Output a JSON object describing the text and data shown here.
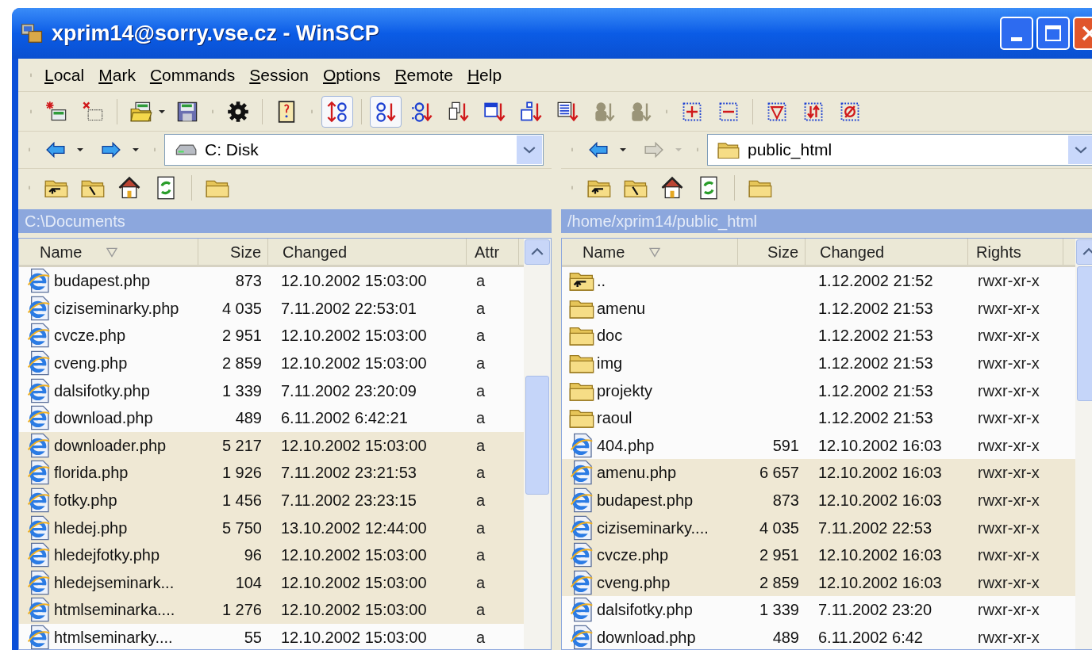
{
  "window": {
    "title": "xprim14@sorry.vse.cz - WinSCP"
  },
  "menu": [
    "Local",
    "Mark",
    "Commands",
    "Session",
    "Options",
    "Remote",
    "Help"
  ],
  "toolbar": [
    {
      "kind": "grip"
    },
    {
      "kind": "new-session",
      "pressed": false
    },
    {
      "kind": "close-session",
      "pressed": false
    },
    {
      "kind": "sep"
    },
    {
      "kind": "open",
      "pressed": false
    },
    {
      "kind": "save",
      "pressed": false
    },
    {
      "kind": "grip"
    },
    {
      "kind": "gear",
      "pressed": false
    },
    {
      "kind": "sep"
    },
    {
      "kind": "book",
      "pressed": false
    },
    {
      "kind": "grip"
    },
    {
      "kind": "sort-toggle",
      "pressed": true
    },
    {
      "kind": "sep"
    },
    {
      "kind": "sort-name",
      "pressed": true
    },
    {
      "kind": "sort-ext",
      "pressed": false
    },
    {
      "kind": "sort-type",
      "pressed": false
    },
    {
      "kind": "sort-date",
      "pressed": false
    },
    {
      "kind": "sort-size",
      "pressed": false
    },
    {
      "kind": "sort-attr",
      "pressed": false
    },
    {
      "kind": "sort-owner",
      "pressed": false
    },
    {
      "kind": "sort-group",
      "pressed": false
    },
    {
      "kind": "grip"
    },
    {
      "kind": "select-plus",
      "pressed": false
    },
    {
      "kind": "select-minus",
      "pressed": false
    },
    {
      "kind": "sep"
    },
    {
      "kind": "select-filter",
      "pressed": false
    },
    {
      "kind": "select-invert",
      "pressed": false
    },
    {
      "kind": "select-none",
      "pressed": false
    }
  ],
  "panels": [
    {
      "nav": [
        {
          "kind": "back",
          "disabled": false
        },
        {
          "kind": "forward",
          "disabled": false
        }
      ],
      "location": {
        "kind": "drive",
        "value": "C: Disk"
      },
      "path": "C:\\Documents",
      "columns": [
        "Name",
        "Size",
        "Changed",
        "Attr"
      ],
      "rows": [
        {
          "kind": "file",
          "name": "budapest.php",
          "size": "873",
          "changed": "12.10.2002 15:03:00",
          "extra": "a",
          "selected": false
        },
        {
          "kind": "file",
          "name": "ciziseminarky.php",
          "size": "4 035",
          "changed": "7.11.2002 22:53:01",
          "extra": "a",
          "selected": false
        },
        {
          "kind": "file",
          "name": "cvcze.php",
          "size": "2 951",
          "changed": "12.10.2002 15:03:00",
          "extra": "a",
          "selected": false
        },
        {
          "kind": "file",
          "name": "cveng.php",
          "size": "2 859",
          "changed": "12.10.2002 15:03:00",
          "extra": "a",
          "selected": false
        },
        {
          "kind": "file",
          "name": "dalsifotky.php",
          "size": "1 339",
          "changed": "7.11.2002 23:20:09",
          "extra": "a",
          "selected": false
        },
        {
          "kind": "file",
          "name": "download.php",
          "size": "489",
          "changed": "6.11.2002 6:42:21",
          "extra": "a",
          "selected": false
        },
        {
          "kind": "file",
          "name": "downloader.php",
          "size": "5 217",
          "changed": "12.10.2002 15:03:00",
          "extra": "a",
          "selected": true
        },
        {
          "kind": "file",
          "name": "florida.php",
          "size": "1 926",
          "changed": "7.11.2002 23:21:53",
          "extra": "a",
          "selected": true
        },
        {
          "kind": "file",
          "name": "fotky.php",
          "size": "1 456",
          "changed": "7.11.2002 23:23:15",
          "extra": "a",
          "selected": true
        },
        {
          "kind": "file",
          "name": "hledej.php",
          "size": "5 750",
          "changed": "13.10.2002 12:44:00",
          "extra": "a",
          "selected": true
        },
        {
          "kind": "file",
          "name": "hledejfotky.php",
          "size": "96",
          "changed": "12.10.2002 15:03:00",
          "extra": "a",
          "selected": true
        },
        {
          "kind": "file",
          "name": "hledejseminark...",
          "size": "104",
          "changed": "12.10.2002 15:03:00",
          "extra": "a",
          "selected": true
        },
        {
          "kind": "file",
          "name": "htmlseminarka....",
          "size": "1 276",
          "changed": "12.10.2002 15:03:00",
          "extra": "a",
          "selected": true
        },
        {
          "kind": "file",
          "name": "htmlseminarky....",
          "size": "55",
          "changed": "12.10.2002 15:03:00",
          "extra": "a",
          "selected": false
        }
      ]
    },
    {
      "nav": [
        {
          "kind": "back",
          "disabled": false
        },
        {
          "kind": "forward",
          "disabled": true
        }
      ],
      "location": {
        "kind": "folder",
        "value": "public_html"
      },
      "path": "/home/xprim14/public_html",
      "columns": [
        "Name",
        "Size",
        "Changed",
        "Rights"
      ],
      "rows": [
        {
          "kind": "parent",
          "name": "..",
          "changed": "1.12.2002 21:52",
          "extra": "rwxr-xr-x",
          "selected": false
        },
        {
          "kind": "folder",
          "name": "amenu",
          "changed": "1.12.2002 21:53",
          "extra": "rwxr-xr-x",
          "selected": false
        },
        {
          "kind": "folder",
          "name": "doc",
          "changed": "1.12.2002 21:53",
          "extra": "rwxr-xr-x",
          "selected": false
        },
        {
          "kind": "folder",
          "name": "img",
          "changed": "1.12.2002 21:53",
          "extra": "rwxr-xr-x",
          "selected": false
        },
        {
          "kind": "folder",
          "name": "projekty",
          "changed": "1.12.2002 21:53",
          "extra": "rwxr-xr-x",
          "selected": false
        },
        {
          "kind": "folder",
          "name": "raoul",
          "changed": "1.12.2002 21:53",
          "extra": "rwxr-xr-x",
          "selected": false
        },
        {
          "kind": "file",
          "name": "404.php",
          "size": "591",
          "changed": "12.10.2002 16:03",
          "extra": "rwxr-xr-x",
          "selected": false
        },
        {
          "kind": "file",
          "name": "amenu.php",
          "size": "6 657",
          "changed": "12.10.2002 16:03",
          "extra": "rwxr-xr-x",
          "selected": true
        },
        {
          "kind": "file",
          "name": "budapest.php",
          "size": "873",
          "changed": "12.10.2002 16:03",
          "extra": "rwxr-xr-x",
          "selected": true
        },
        {
          "kind": "file",
          "name": "ciziseminarky....",
          "size": "4 035",
          "changed": "7.11.2002 22:53",
          "extra": "rwxr-xr-x",
          "selected": true
        },
        {
          "kind": "file",
          "name": "cvcze.php",
          "size": "2 951",
          "changed": "12.10.2002 16:03",
          "extra": "rwxr-xr-x",
          "selected": true
        },
        {
          "kind": "file",
          "name": "cveng.php",
          "size": "2 859",
          "changed": "12.10.2002 16:03",
          "extra": "rwxr-xr-x",
          "selected": true
        },
        {
          "kind": "file",
          "name": "dalsifotky.php",
          "size": "1 339",
          "changed": "7.11.2002 23:20",
          "extra": "rwxr-xr-x",
          "selected": false
        },
        {
          "kind": "file",
          "name": "download.php",
          "size": "489",
          "changed": "6.11.2002 6:42",
          "extra": "rwxr-xr-x",
          "selected": false
        }
      ]
    }
  ]
}
